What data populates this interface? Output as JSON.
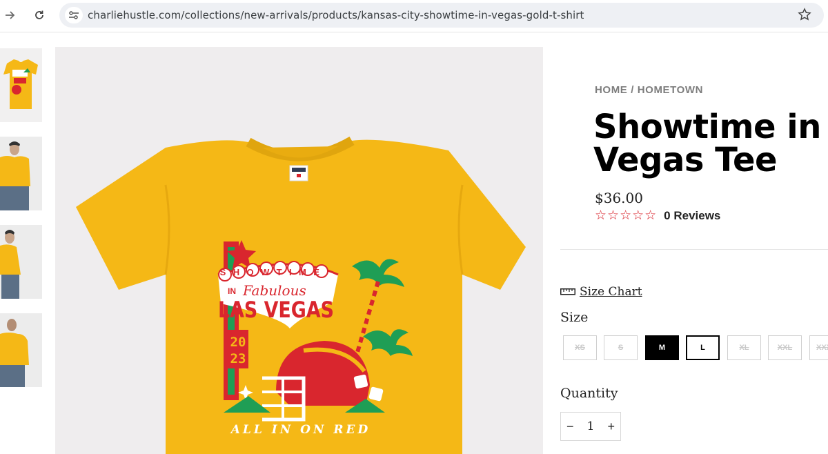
{
  "browser": {
    "url": "charliehustle.com/collections/new-arrivals/products/kansas-city-showtime-in-vegas-gold-t-shirt"
  },
  "product": {
    "breadcrumb": [
      "HOME",
      "HOMETOWN"
    ],
    "breadcrumb_separator": "/",
    "title": "Showtime in Vegas Tee",
    "price": "$36.00",
    "rating": {
      "stars": 0,
      "max": 5,
      "reviews_label": "0 Reviews"
    },
    "size_chart_label": "Size Chart",
    "size_label": "Size",
    "sizes": [
      {
        "label": "XS",
        "state": "unavailable"
      },
      {
        "label": "S",
        "state": "unavailable"
      },
      {
        "label": "M",
        "state": "selected"
      },
      {
        "label": "L",
        "state": "available"
      },
      {
        "label": "XL",
        "state": "unavailable"
      },
      {
        "label": "XXL",
        "state": "unavailable"
      },
      {
        "label": "XXXL",
        "state": "unavailable"
      }
    ],
    "quantity_label": "Quantity",
    "quantity": {
      "minus": "−",
      "value": "1",
      "plus": "+"
    }
  },
  "artwork": {
    "showtime": "SHOWTIME",
    "in": "IN",
    "fabulous": "Fabulous",
    "las_vegas": "LAS VEGAS",
    "year_top": "20",
    "year_bottom": "23",
    "tagline": "ALL IN ON RED"
  },
  "colors": {
    "shirt": "#f5b816",
    "accent_red": "#d9262e",
    "palm_green": "#1f9e55"
  }
}
